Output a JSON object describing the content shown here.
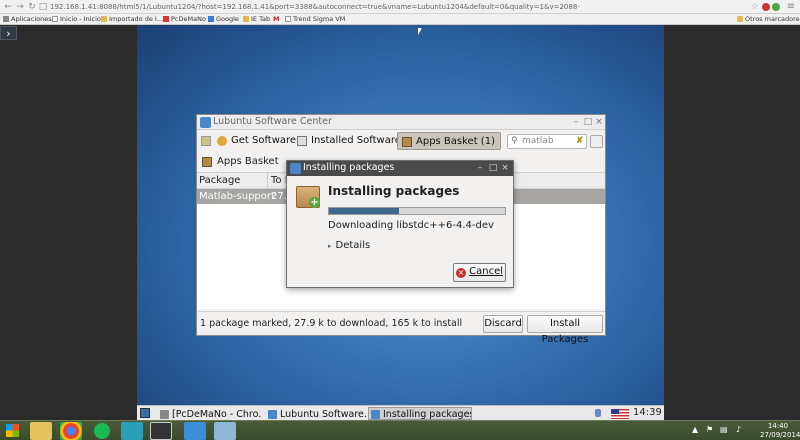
{
  "browser": {
    "url": "192.168.1.41:8088/html5/1/Lubuntu1204/?host=192.168.1.41&port=3388&autoconnect=true&vname=Lubuntu1204&default=0&quality=1&v=2088-",
    "bookmarks": [
      {
        "label": "Aplicaciones",
        "icon": "apps-grid-icon"
      },
      {
        "label": "Inicio - Inicio",
        "icon": "page-icon"
      },
      {
        "label": "Importado de I...",
        "icon": "folder-icon"
      },
      {
        "label": "PcDeMaNo",
        "icon": "pcdemano-icon"
      },
      {
        "label": "Google",
        "icon": "google-icon"
      },
      {
        "label": "IE Tab",
        "icon": "folder-icon"
      },
      {
        "label": "",
        "icon": "gmail-icon"
      },
      {
        "label": "Trend Sigma VM",
        "icon": "page-icon"
      }
    ],
    "other_bookmarks": "Otros marcadores"
  },
  "software_center": {
    "title": "Lubuntu Software Center",
    "tabs": {
      "get_software": "Get Software",
      "installed_software": "Installed Software",
      "apps_basket": "Apps Basket (1)"
    },
    "search_value": "matlab",
    "section_title": "Apps Basket",
    "columns": {
      "package": "Package",
      "to_download": "To D"
    },
    "row": {
      "package": "Matlab-support",
      "size": "27.9"
    },
    "status": "1 package marked, 27.9 k to download, 165 k to install",
    "discard": "Discard",
    "install": "Install Packages"
  },
  "dialog": {
    "title": "Installing packages",
    "heading": "Installing packages",
    "progress": 0.4,
    "message": "Downloading libstdc++6-4.4-dev",
    "details": "Details",
    "cancel": "Cancel"
  },
  "lubuntu_panel": {
    "tasks": [
      "[PcDeMaNo - Chro...",
      "Lubuntu Software...",
      "Installing packages"
    ],
    "clock": "14:39"
  },
  "windows_tray": {
    "time": "14:40",
    "date": "27/09/2014"
  },
  "colors": {
    "desktop": "#3a78b8",
    "progress_fill": "#3f6690",
    "dialog_title": "#4b4b4b",
    "taskbar": "#3a4a2c"
  }
}
